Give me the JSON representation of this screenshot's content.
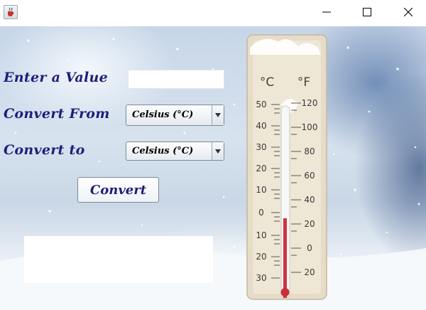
{
  "titlebar": {
    "app_icon": "java-cup-icon",
    "minimize_icon": "minimize-icon",
    "maximize_icon": "maximize-icon",
    "close_icon": "close-icon"
  },
  "form": {
    "value_label": "Enter a Value",
    "value_input": "",
    "from_label": "Convert From",
    "from_selected": "Celsius (°C)",
    "to_label": "Convert to",
    "to_selected": "Celsius (°C)",
    "convert_button": "Convert",
    "result": ""
  },
  "background": {
    "scale_c_unit": "°C",
    "scale_f_unit": "°F",
    "celsius_ticks": [
      "50",
      "40",
      "30",
      "20",
      "10",
      "0",
      "10",
      "20",
      "30"
    ],
    "fahrenheit_ticks": [
      "120",
      "100",
      "80",
      "60",
      "40",
      "20",
      "0",
      "20"
    ],
    "mercury_color": "#d0343c",
    "label_color": "#1d1f7a"
  }
}
